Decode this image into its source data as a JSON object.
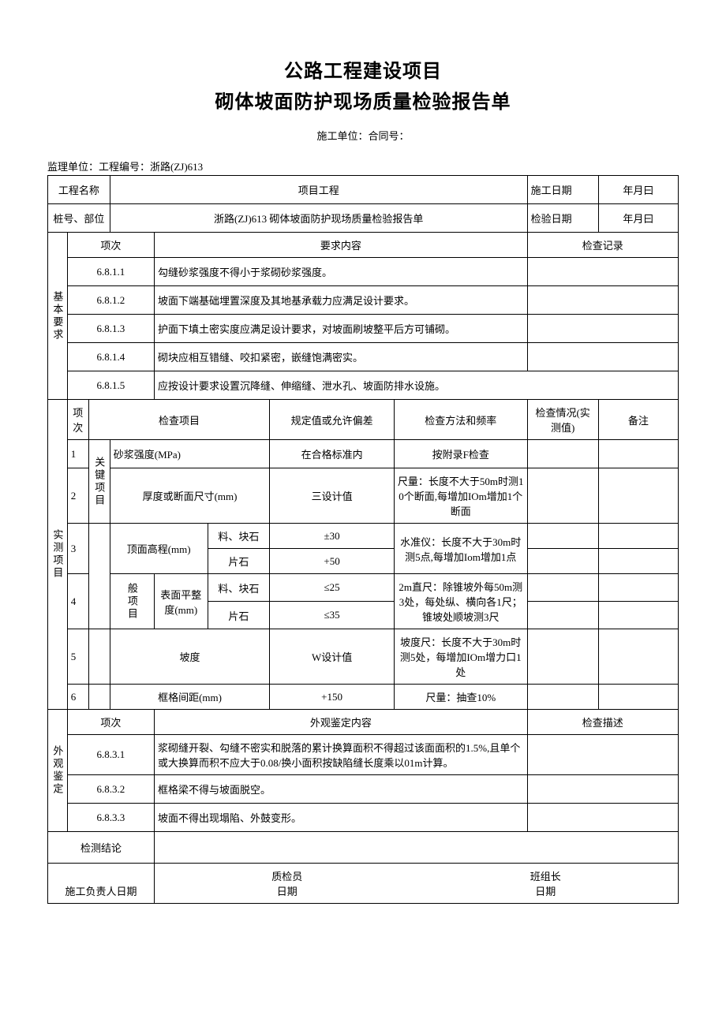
{
  "title": {
    "line1": "公路工程建设项目",
    "line2": "砌体坡面防护现场质量检验报告单"
  },
  "header": {
    "construction_contract": "施工单位：合同号：",
    "supervisor_projectno": "监理单位：工程编号：浙路(ZJ)613"
  },
  "info": {
    "project_name_label": "工程名称",
    "project_name_value": "项目工程",
    "construction_date_label": "施工日期",
    "construction_date_value": "年月曰",
    "pile_label": "桩号、部位",
    "pile_value": "浙路(ZJ)613 砌体坡面防护现场质量检验报告单",
    "inspect_date_label": "检验日期",
    "inspect_date_value": "年月曰"
  },
  "basic": {
    "section_label": "基本要求",
    "col_index": "项次",
    "col_req": "要求内容",
    "col_record": "检查记录",
    "rows": [
      {
        "no": "6.8.1.1",
        "content": "勾缝砂浆强度不得小于浆砌砂浆强度。"
      },
      {
        "no": "6.8.1.2",
        "content": "坡面下端基础埋置深度及其地基承载力应满足设计要求。"
      },
      {
        "no": "6.8.1.3",
        "content": "护面下填土密实度应满足设计要求，对坡面刷坡整平后方可铺砌。"
      },
      {
        "no": "6.8.1.4",
        "content": "砌块应相互错缝、咬扣紧密，嵌缝饱满密实。"
      },
      {
        "no": "6.8.1.5",
        "content": "应按设计要求设置沉降缝、伸缩缝、泄水孔、坡面防排水设施。"
      }
    ]
  },
  "measure": {
    "section_label": "实测项目",
    "key_group": "关键项目",
    "gen_group": "般项目",
    "col_index": "项次",
    "col_item": "检查项目",
    "col_allow": "规定值或允许偏差",
    "col_method": "检查方法和频率",
    "col_result": "检查情况(实测值)",
    "col_note": "备注",
    "rows": [
      {
        "idx": "1",
        "item": "砂浆强度(MPa)",
        "allow": "在合格标准内",
        "method": "按附录F检查"
      },
      {
        "idx": "2",
        "item": "厚度或断面尺寸(mm)",
        "allow": "三设计值",
        "method": "尺量：长度不大于50m时测10个断面,每增加IOm增加1个断面"
      },
      {
        "idx": "3",
        "item_main": "顶面高程(mm)",
        "sub1_label": "料、块石",
        "sub1_allow": "±30",
        "sub2_label": "片石",
        "sub2_allow": "+50",
        "method": "水准仪：长度不大于30m时测5点,每增加Iom增加1点"
      },
      {
        "idx": "4",
        "item_main": "表面平整度(mm)",
        "sub1_label": "料、块石",
        "sub1_allow": "≤25",
        "sub2_label": "片石",
        "sub2_allow": "≤35",
        "method": "2m直尺：除锥坡外每50m测3处，每处纵、横向各1尺；锥坡处顺坡测3尺"
      },
      {
        "idx": "5",
        "item": "坡度",
        "allow": "W设计值",
        "method": "坡度尺：长度不大于30m时测5处，每增加IOm增力口1处"
      },
      {
        "idx": "6",
        "item": "框格间距(mm)",
        "allow": "+150",
        "method": "尺量：抽查10%"
      }
    ]
  },
  "appearance": {
    "section_label": "外观鉴定",
    "col_index": "项次",
    "col_content": "外观鉴定内容",
    "col_desc": "检查描述",
    "rows": [
      {
        "no": "6.8.3.1",
        "content": "浆砌缝开裂、勾缝不密实和脱落的累计换算面积不得超过该面面积的1.5%,且单个或大换算而积不应大于0.08/换小面积按缺陷缝长度乘以01m计算。"
      },
      {
        "no": "6.8.3.2",
        "content": "框格梁不得与坡面脱空。"
      },
      {
        "no": "6.8.3.3",
        "content": "坡面不得出现塌陷、外鼓变形。"
      }
    ]
  },
  "conclusion": {
    "label": "检测结论"
  },
  "signatures": {
    "left": "施工负责人日期",
    "mid_top": "质检员",
    "mid_bot": "日期",
    "right_top": "班组长",
    "right_bot": "日期"
  }
}
